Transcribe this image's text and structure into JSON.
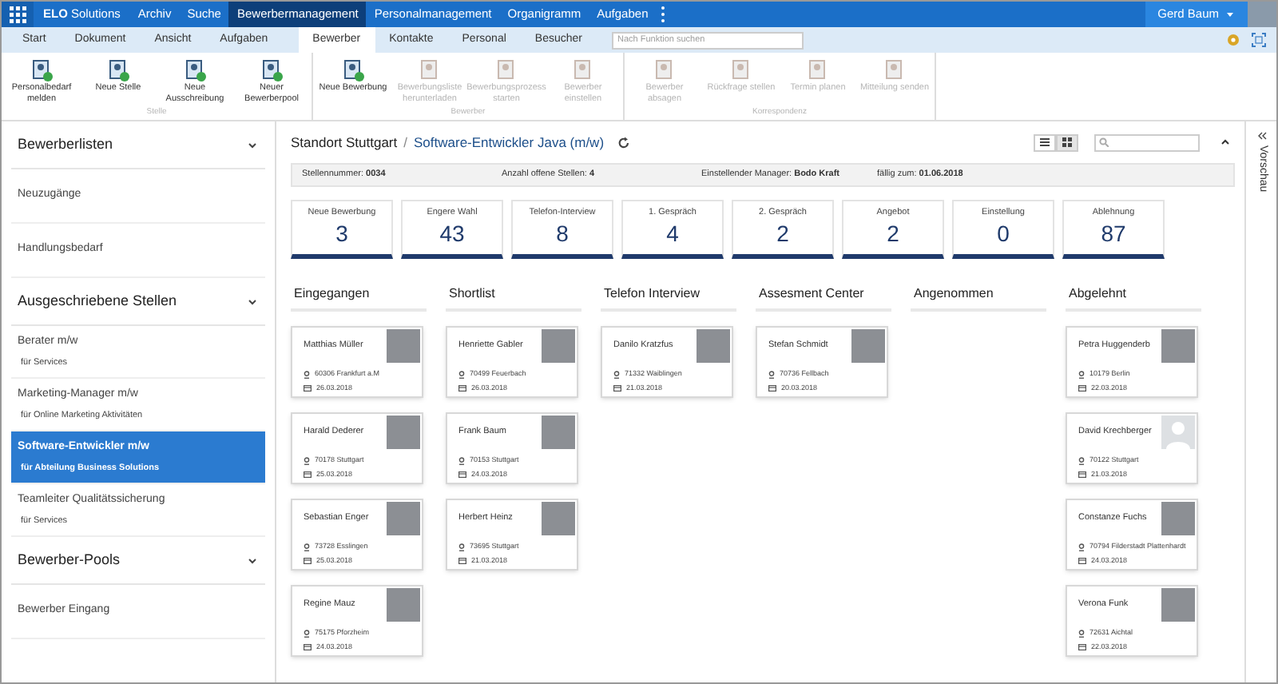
{
  "top_nav": {
    "logo": "**ELO** Solutions",
    "items": [
      {
        "label": "Archiv",
        "selected": false
      },
      {
        "label": "Suche",
        "selected": false
      },
      {
        "label": "Bewerbermanagement",
        "selected": true
      },
      {
        "label": "Personalmanagement",
        "selected": false
      },
      {
        "label": "Organigramm",
        "selected": false
      },
      {
        "label": "Aufgaben",
        "selected": false
      }
    ],
    "user": {
      "name": "Gerd Baum"
    }
  },
  "ribbon_tabs": [
    {
      "label": "Start",
      "selected": false
    },
    {
      "label": "Dokument",
      "selected": false
    },
    {
      "label": "Ansicht",
      "selected": false
    },
    {
      "label": "Aufgaben",
      "selected": false
    },
    {
      "label": "Bewerber",
      "selected": true
    },
    {
      "label": "Kontakte",
      "selected": false
    },
    {
      "label": "Personal",
      "selected": false
    },
    {
      "label": "Besucher",
      "selected": false
    }
  ],
  "function_search": {
    "placeholder": "Nach Funktion suchen"
  },
  "ribbon_groups": [
    {
      "title": "Stelle",
      "buttons": [
        {
          "label": "Personalbedarf melden",
          "disabled": false
        },
        {
          "label": "Neue Stelle",
          "disabled": false
        },
        {
          "label": "Neue Ausschreibung",
          "disabled": false
        },
        {
          "label": "Neuer Bewerberpool",
          "disabled": false
        }
      ]
    },
    {
      "title": "Bewerber",
      "buttons": [
        {
          "label": "Neue Bewerbung",
          "disabled": false
        },
        {
          "label": "Bewerbungsliste herunterladen",
          "disabled": true
        },
        {
          "label": "Bewerbungsprozess starten",
          "disabled": true
        },
        {
          "label": "Bewerber einstellen",
          "disabled": true
        }
      ]
    },
    {
      "title": "Korrespondenz",
      "buttons": [
        {
          "label": "Bewerber absagen",
          "disabled": true
        },
        {
          "label": "Rückfrage stellen",
          "disabled": true
        },
        {
          "label": "Termin planen",
          "disabled": true
        },
        {
          "label": "Mitteilung senden",
          "disabled": true
        }
      ]
    }
  ],
  "sidebar": {
    "sections": [
      {
        "title": "Bewerberlisten",
        "expanded": true,
        "items": [
          {
            "title": "Neuzugänge",
            "selected": false
          },
          {
            "title": "Handlungsbedarf",
            "selected": false
          }
        ]
      },
      {
        "title": "Ausgeschriebene Stellen",
        "expanded": true,
        "items": [
          {
            "title": "Berater m/w",
            "subtitle": "für Services",
            "selected": false
          },
          {
            "title": "Marketing-Manager m/w",
            "subtitle": "für Online Marketing Aktivitäten",
            "selected": false
          },
          {
            "title": "Software-Entwickler m/w",
            "subtitle": "für Abteilung Business Solutions",
            "selected": true
          },
          {
            "title": "Teamleiter Qualitätssicherung",
            "subtitle": "für Services",
            "selected": false
          }
        ]
      },
      {
        "title": "Bewerber-Pools",
        "expanded": true,
        "items": [
          {
            "title": "Bewerber Eingang",
            "selected": false
          }
        ]
      }
    ]
  },
  "breadcrumb": {
    "location": "Standort Stuttgart",
    "separator": "/",
    "position": "Software-Entwickler Java (m/w)"
  },
  "view_toggle": [
    {
      "selected": false
    },
    {
      "selected": true
    }
  ],
  "info_bar": [
    "Stellennummer: **0034**",
    "Anzahl offene Stellen: **4**",
    "Einstellender Manager: **Bodo Kraft**",
    "fällig zum: **01.06.2018**"
  ],
  "stats": [
    {
      "label": "Neue Bewerbung",
      "count": "3"
    },
    {
      "label": "Engere Wahl",
      "count": "43"
    },
    {
      "label": "Telefon-Interview",
      "count": "8"
    },
    {
      "label": "1. Gespräch",
      "count": "4"
    },
    {
      "label": "2. Gespräch",
      "count": "2"
    },
    {
      "label": "Angebot",
      "count": "2"
    },
    {
      "label": "Einstellung",
      "count": "0"
    },
    {
      "label": "Ablehnung",
      "count": "87"
    }
  ],
  "board": [
    {
      "title": "Eingegangen",
      "cards": [
        {
          "name": "Matthias Müller",
          "location": "60306 Frankfurt a.M",
          "date": "26.03.2018",
          "photo": true
        },
        {
          "name": "Harald Dederer",
          "location": "70178 Stuttgart",
          "date": "25.03.2018",
          "photo": true
        },
        {
          "name": "Sebastian Enger",
          "location": "73728 Esslingen",
          "date": "25.03.2018",
          "photo": true
        },
        {
          "name": "Regine Mauz",
          "location": "75175 Pforzheim",
          "date": "24.03.2018",
          "photo": true
        }
      ]
    },
    {
      "title": "Shortlist",
      "cards": [
        {
          "name": "Henriette Gabler",
          "location": "70499 Feuerbach",
          "date": "26.03.2018",
          "photo": true
        },
        {
          "name": "Frank Baum",
          "location": "70153 Stuttgart",
          "date": "24.03.2018",
          "photo": true
        },
        {
          "name": "Herbert Heinz",
          "location": "73695 Stuttgart",
          "date": "21.03.2018",
          "photo": true
        }
      ]
    },
    {
      "title": "Telefon Interview",
      "cards": [
        {
          "name": "Danilo Kratzfus",
          "location": "71332 Waiblingen",
          "date": "21.03.2018",
          "photo": true
        }
      ]
    },
    {
      "title": "Assesment Center",
      "cards": [
        {
          "name": "Stefan Schmidt",
          "location": "70736 Fellbach",
          "date": "20.03.2018",
          "photo": true
        }
      ]
    },
    {
      "title": "Angenommen"
    },
    {
      "title": "Abgelehnt",
      "cards": [
        {
          "name": "Petra Huggenderb",
          "location": "10179 Berlin",
          "date": "22.03.2018",
          "photo": true
        },
        {
          "name": "David Krechberger",
          "location": "70122 Stuttgart",
          "date": "21.03.2018",
          "photo": false
        },
        {
          "name": "Constanze Fuchs",
          "location": "70794 Filderstadt Plattenhardt",
          "date": "24.03.2018",
          "photo": true
        },
        {
          "name": "Verona Funk",
          "location": "72631 Aichtal",
          "date": "22.03.2018",
          "photo": true
        }
      ]
    }
  ],
  "preview_panel": {
    "label": "Vorschau"
  }
}
